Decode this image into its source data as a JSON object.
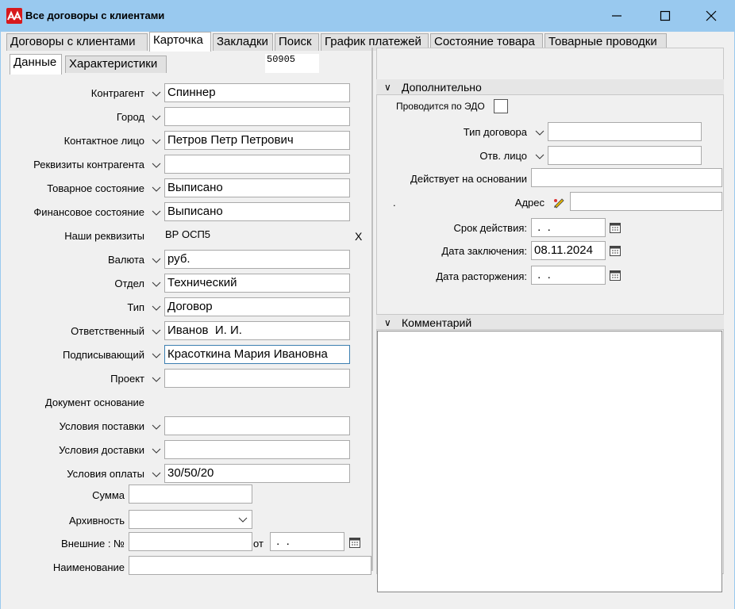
{
  "window": {
    "title": "Все договоры с клиентами"
  },
  "tabs": [
    "Договоры с клиентами",
    "Карточка",
    "Закладки",
    "Поиск",
    "График платежей",
    "Состояние товара",
    "Товарные проводки"
  ],
  "subtabs": [
    "Данные",
    "Характеристики"
  ],
  "record_id": "50905",
  "form": {
    "kontragent": {
      "label": "Контрагент",
      "value": "Спиннер"
    },
    "gorod": {
      "label": "Город",
      "value": ""
    },
    "kontakt": {
      "label": "Контактное лицо",
      "value": "Петров Петр Петрович"
    },
    "rekvizity": {
      "label": "Реквизиты контрагента",
      "value": ""
    },
    "tovar_sost": {
      "label": "Товарное состояние",
      "value": "Выписано"
    },
    "fin_sost": {
      "label": "Финансовое состояние",
      "value": "Выписано"
    },
    "nashi_rekv": {
      "label": "Наши реквизиты",
      "value": "ВР ОСП5",
      "clear": "X"
    },
    "valuta": {
      "label": "Валюта",
      "value": "руб."
    },
    "otdel": {
      "label": "Отдел",
      "value": "Технический"
    },
    "tip": {
      "label": "Тип",
      "value": "Договор"
    },
    "otvetstv": {
      "label": "Ответственный",
      "value": "Иванов  И. И."
    },
    "podpis": {
      "label": "Подписывающий",
      "value": "Красоткина Мария Ивановна"
    },
    "proekt": {
      "label": "Проект",
      "value": ""
    },
    "dok_osn": {
      "label": "Документ основание"
    },
    "usl_post": {
      "label": "Условия поставки",
      "value": ""
    },
    "usl_dost": {
      "label": "Условия доставки",
      "value": ""
    },
    "usl_opl": {
      "label": "Условия оплаты",
      "value": "30/50/20"
    },
    "summa": {
      "label": "Сумма",
      "value": ""
    },
    "arhiv": {
      "label": "Архивность",
      "value": ""
    },
    "vneshnie": {
      "label": "Внешние : №",
      "value": "",
      "ot_label": "от",
      "ot_value": " .  ."
    },
    "naimen": {
      "label": "Наименование",
      "value": ""
    }
  },
  "extra": {
    "header": "Дополнительно",
    "edo_label": "Проводится по ЭДО",
    "tip_dog": {
      "label": "Тип договора",
      "value": ""
    },
    "otv_lico": {
      "label": "Отв. лицо",
      "value": ""
    },
    "osnovanie": {
      "label": "Действует на основании",
      "value": ""
    },
    "dot": ".",
    "adres": {
      "label": "Адрес",
      "value": ""
    },
    "srok": {
      "label": "Срок действия:",
      "value": " .  ."
    },
    "data_zakl": {
      "label": "Дата заключения:",
      "value": "08.11.2024"
    },
    "data_rast": {
      "label": "Дата расторжения:",
      "value": " .  ."
    }
  },
  "comment": {
    "header": "Комментарий",
    "value": ""
  }
}
